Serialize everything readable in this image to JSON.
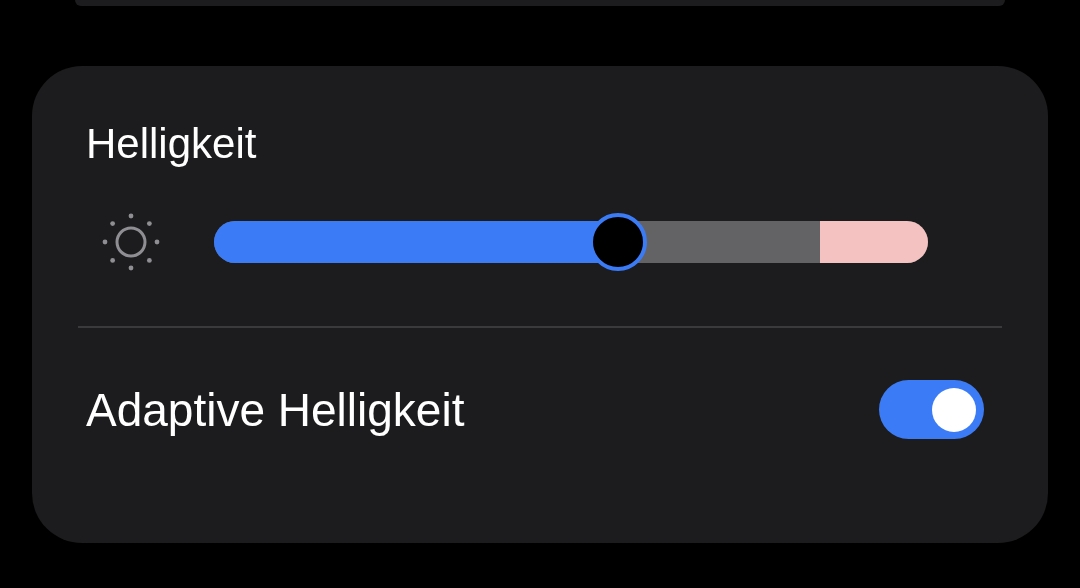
{
  "brightness_card": {
    "title": "Helligkeit",
    "slider": {
      "level": 0.566
    }
  },
  "adaptive_brightness": {
    "label": "Adaptive Helligkeit",
    "on": true
  }
}
